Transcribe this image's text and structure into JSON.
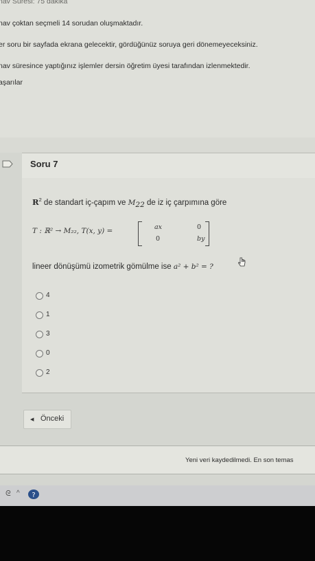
{
  "info": {
    "duration": "nav Süresi: 75 dakika",
    "question_count": "nav çoktan seçmeli 14 sorudan oluşmaktadır.",
    "navigation_rule": "er soru bir sayfada ekrana gelecektir, gördüğünüz soruya geri dönemeyeceksiniz.",
    "monitoring": "nav süresince yaptığınız işlemler dersin öğretim üyesi tarafından izlenmektedir.",
    "wishes": "aşarılar"
  },
  "question": {
    "title": "Soru 7",
    "stem_r": "R",
    "stem_r_sup": "2",
    "stem_part1": " de standart iç-çapım ve ",
    "stem_m": "M",
    "stem_m_sub": "22",
    "stem_part2": " de iz iç çarpımına göre",
    "formula_lhs": "T : ℝ² → M₂₂,  T(x, y) =",
    "matrix": [
      "ax",
      "0",
      "0",
      "by"
    ],
    "prompt_text": "lineer dönüşümü izometrik gömülme ise ",
    "prompt_math": "a² + b² = ?",
    "options": [
      "4",
      "1",
      "3",
      "0",
      "2"
    ]
  },
  "navigation": {
    "prev_label": "Önceki"
  },
  "status": {
    "save_message": "Yeni veri kaydedilmedi. En son temas"
  },
  "colors": {
    "page_bg": "#dfe0da",
    "panel_border": "#b8bab4",
    "bezel": "#060606"
  }
}
